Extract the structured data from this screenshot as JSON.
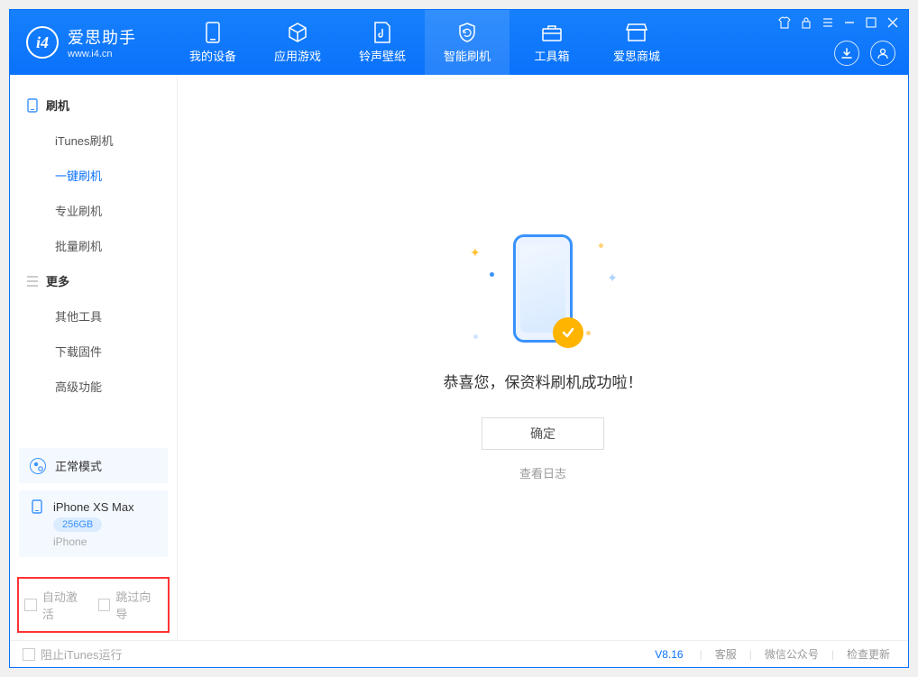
{
  "brand": {
    "name": "爱思助手",
    "url": "www.i4.cn"
  },
  "nav": [
    {
      "label": "我的设备"
    },
    {
      "label": "应用游戏"
    },
    {
      "label": "铃声壁纸"
    },
    {
      "label": "智能刷机"
    },
    {
      "label": "工具箱"
    },
    {
      "label": "爱思商城"
    }
  ],
  "sidebar": {
    "group1_label": "刷机",
    "items1": [
      {
        "label": "iTunes刷机"
      },
      {
        "label": "一键刷机"
      },
      {
        "label": "专业刷机"
      },
      {
        "label": "批量刷机"
      }
    ],
    "group2_label": "更多",
    "items2": [
      {
        "label": "其他工具"
      },
      {
        "label": "下载固件"
      },
      {
        "label": "高级功能"
      }
    ]
  },
  "mode_card": {
    "label": "正常模式"
  },
  "device_card": {
    "name": "iPhone XS Max",
    "capacity": "256GB",
    "type": "iPhone"
  },
  "bottom_box": {
    "auto_activate": "自动激活",
    "skip_wizard": "跳过向导"
  },
  "main": {
    "success_msg": "恭喜您，保资料刷机成功啦！",
    "ok_btn": "确定",
    "view_log": "查看日志"
  },
  "footer": {
    "stop_itunes": "阻止iTunes运行",
    "version": "V8.16",
    "link_support": "客服",
    "link_wechat": "微信公众号",
    "link_update": "检查更新"
  }
}
